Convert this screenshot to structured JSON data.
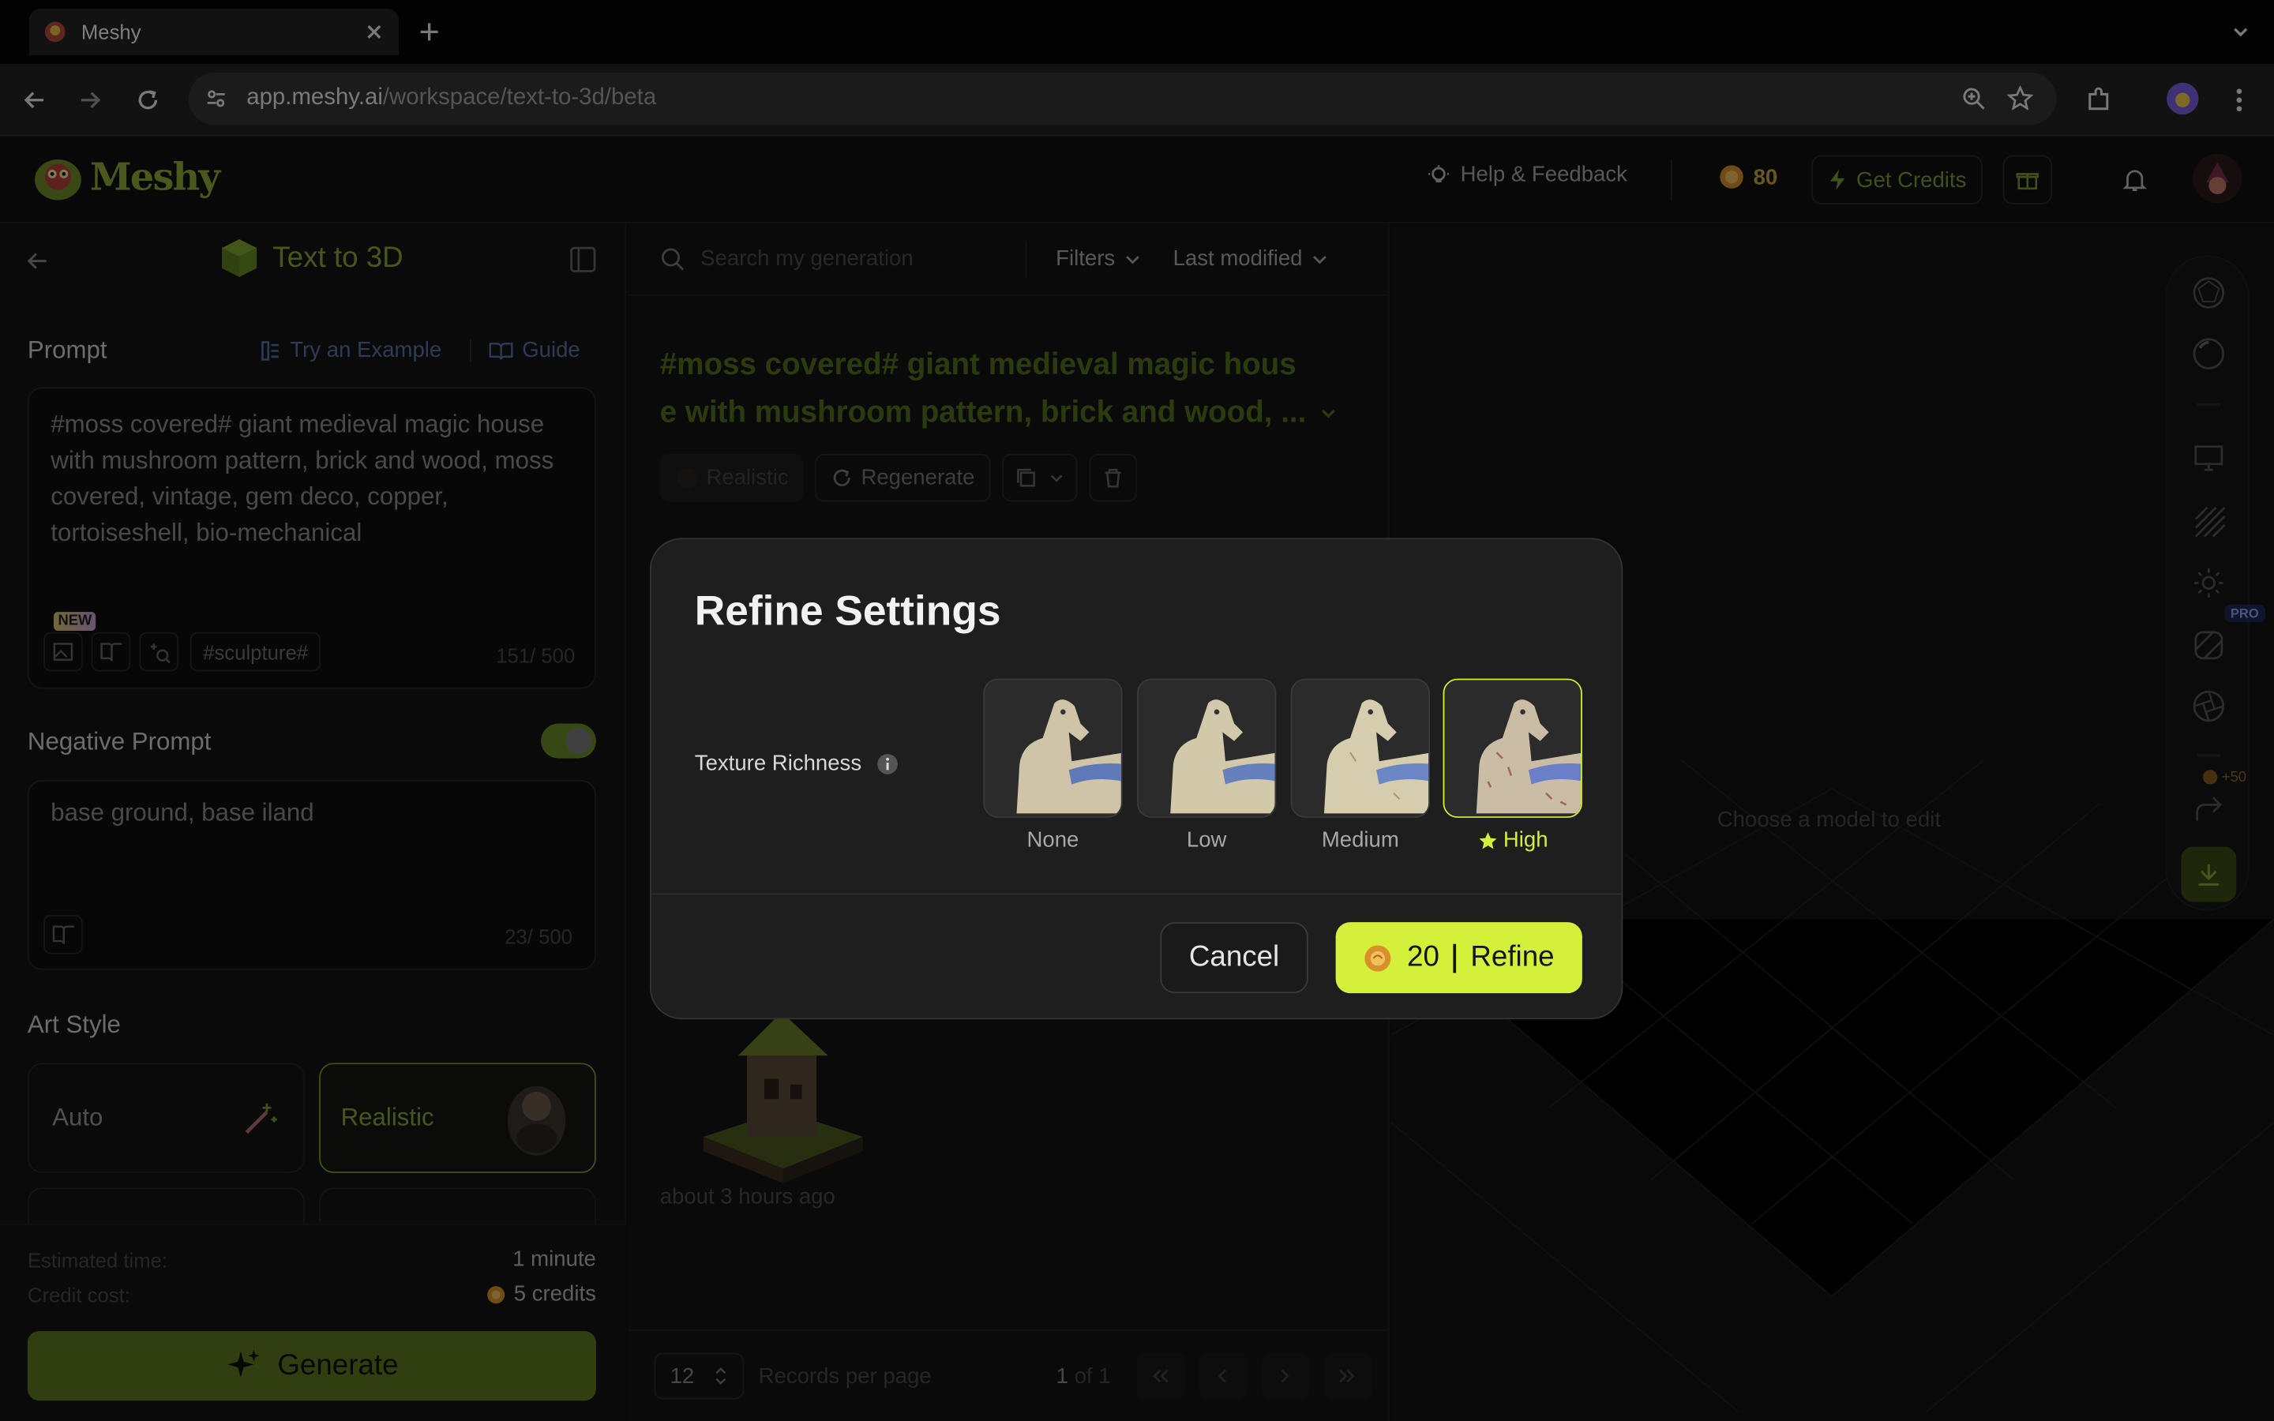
{
  "browser": {
    "tab_title": "Meshy",
    "url_host": "app.meshy.ai",
    "url_path": "/workspace/text-to-3d/beta"
  },
  "header": {
    "logo": "Meshy",
    "help": "Help & Feedback",
    "credits": "80",
    "get_credits": "Get Credits"
  },
  "left": {
    "title": "Text to 3D",
    "prompt_label": "Prompt",
    "try_example": "Try an Example",
    "guide": "Guide",
    "prompt_text": "#moss covered# giant medieval magic house with mushroom pattern, brick and wood, moss covered, vintage, gem deco, copper, tortoiseshell, bio-mechanical",
    "new_badge": "NEW",
    "sculpture_tag": "#sculpture#",
    "prompt_count": "151/ 500",
    "negative_label": "Negative Prompt",
    "negative_text": "base ground, base iland",
    "negative_count": "23/ 500",
    "art_style_label": "Art Style",
    "style_auto": "Auto",
    "style_realistic": "Realistic",
    "est_time_label": "Estimated time:",
    "est_time_value": "1 minute",
    "credit_cost_label": "Credit cost:",
    "credit_cost_value": "5 credits",
    "generate": "Generate"
  },
  "middle": {
    "search_placeholder": "Search my generation",
    "filters": "Filters",
    "sort": "Last modified",
    "gen_title_line1": "#moss covered# giant medieval magic hous",
    "gen_title_line2": "e with mushroom pattern, brick and wood, ...",
    "tag_style": "Realistic",
    "regenerate": "Regenerate",
    "time_ago": "about 3 hours ago",
    "per_page_value": "12",
    "records_per_page": "Records per page",
    "page_current": "1",
    "page_of": "of 1"
  },
  "right": {
    "empty_hint": "Choose a model to edit",
    "pro_badge": "PRO",
    "plus_credits": "+50"
  },
  "modal": {
    "title": "Refine Settings",
    "setting_label": "Texture Richness",
    "options": [
      "None",
      "Low",
      "Medium",
      "High"
    ],
    "selected": "High",
    "cancel": "Cancel",
    "cost": "20",
    "refine": "Refine"
  },
  "colors": {
    "accent": "#d4f03a",
    "brand_green": "#7d9a2e",
    "coin": "#d9902a"
  }
}
